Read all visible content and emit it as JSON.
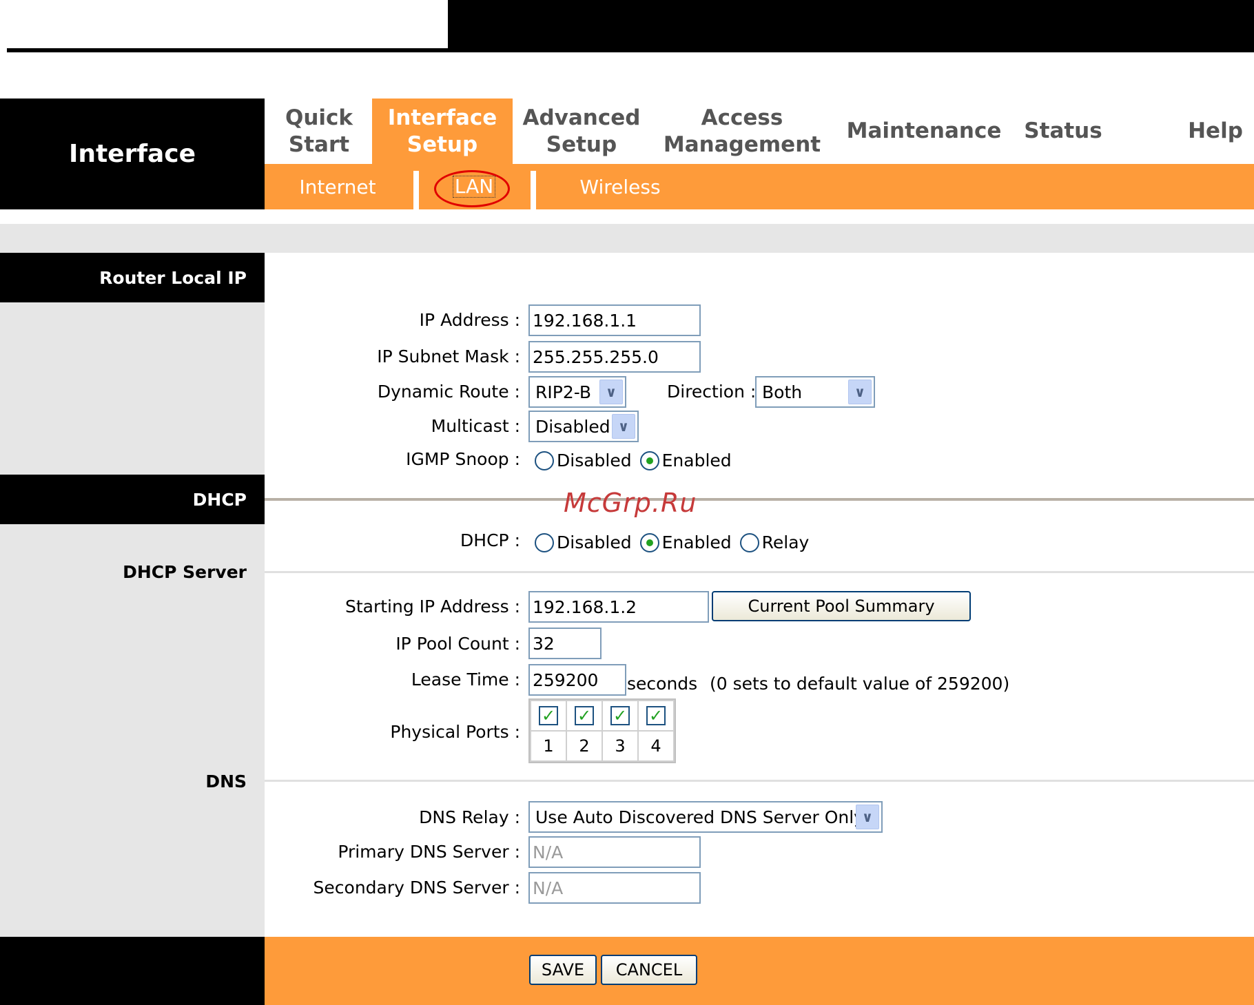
{
  "brand": "Interface",
  "nav": {
    "tabs": [
      {
        "line1": "Quick",
        "line2": "Start"
      },
      {
        "line1": "Interface",
        "line2": "Setup"
      },
      {
        "line1": "Advanced",
        "line2": "Setup"
      },
      {
        "line1": "Access",
        "line2": "Management"
      },
      {
        "line1": "Maintenance",
        "line2": ""
      },
      {
        "line1": "Status",
        "line2": ""
      },
      {
        "line1": "Help",
        "line2": ""
      }
    ],
    "subtabs": [
      "Internet",
      "LAN",
      "Wireless"
    ]
  },
  "sections": {
    "router_local_ip": "Router Local IP",
    "dhcp": "DHCP",
    "dhcp_server": "DHCP Server",
    "dns": "DNS"
  },
  "router": {
    "ip_label": "IP Address :",
    "ip_value": "192.168.1.1",
    "mask_label": "IP Subnet Mask :",
    "mask_value": "255.255.255.0",
    "route_label": "Dynamic Route :",
    "route_value": "RIP2-B",
    "direction_label": "Direction :",
    "direction_value": "Both",
    "multicast_label": "Multicast :",
    "multicast_value": "Disabled",
    "igmp_label": "IGMP Snoop :",
    "igmp_options": [
      "Disabled",
      "Enabled"
    ]
  },
  "dhcp": {
    "label": "DHCP :",
    "options": [
      "Disabled",
      "Enabled",
      "Relay"
    ],
    "start_label": "Starting IP Address :",
    "start_value": "192.168.1.2",
    "pool_button": "Current Pool Summary",
    "count_label": "IP Pool Count :",
    "count_value": "32",
    "lease_label": "Lease Time :",
    "lease_value": "259200",
    "lease_unit": "seconds",
    "lease_note": "(0 sets to default value of 259200)",
    "ports_label": "Physical Ports :",
    "ports": [
      "1",
      "2",
      "3",
      "4"
    ]
  },
  "dns": {
    "relay_label": "DNS Relay :",
    "relay_value": "Use Auto Discovered DNS Server Only",
    "primary_label": "Primary DNS Server :",
    "primary_value": "N/A",
    "secondary_label": "Secondary DNS Server :",
    "secondary_value": "N/A"
  },
  "footer": {
    "save": "SAVE",
    "cancel": "CANCEL"
  },
  "watermark": "McGrp.Ru",
  "colors": {
    "accent": "#fe9b3a",
    "black": "#000000",
    "panel": "#e6e6e6"
  }
}
